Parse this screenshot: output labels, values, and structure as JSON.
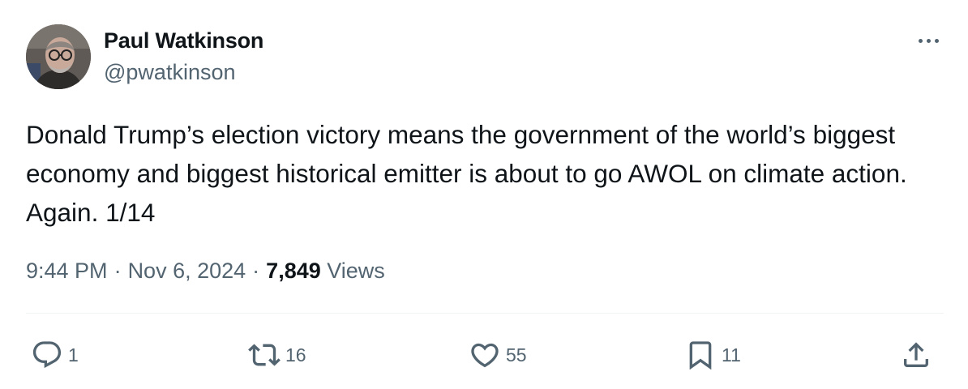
{
  "author": {
    "name": "Paul Watkinson",
    "handle": "@pwatkinson",
    "avatar_icon": "profile-photo"
  },
  "post": {
    "text": "Donald Trump’s election victory means the government of the world’s biggest economy and biggest historical emitter is about to go AWOL on climate action. Again. 1/14"
  },
  "meta": {
    "time": "9:44 PM",
    "separator": "·",
    "date": "Nov 6, 2024",
    "views_count": "7,849",
    "views_label": "Views"
  },
  "actions": {
    "replies": "1",
    "reposts": "16",
    "likes": "55",
    "bookmarks": "11"
  },
  "colors": {
    "text_primary": "#0f1419",
    "text_secondary": "#536471",
    "divider": "#eff3f4"
  }
}
